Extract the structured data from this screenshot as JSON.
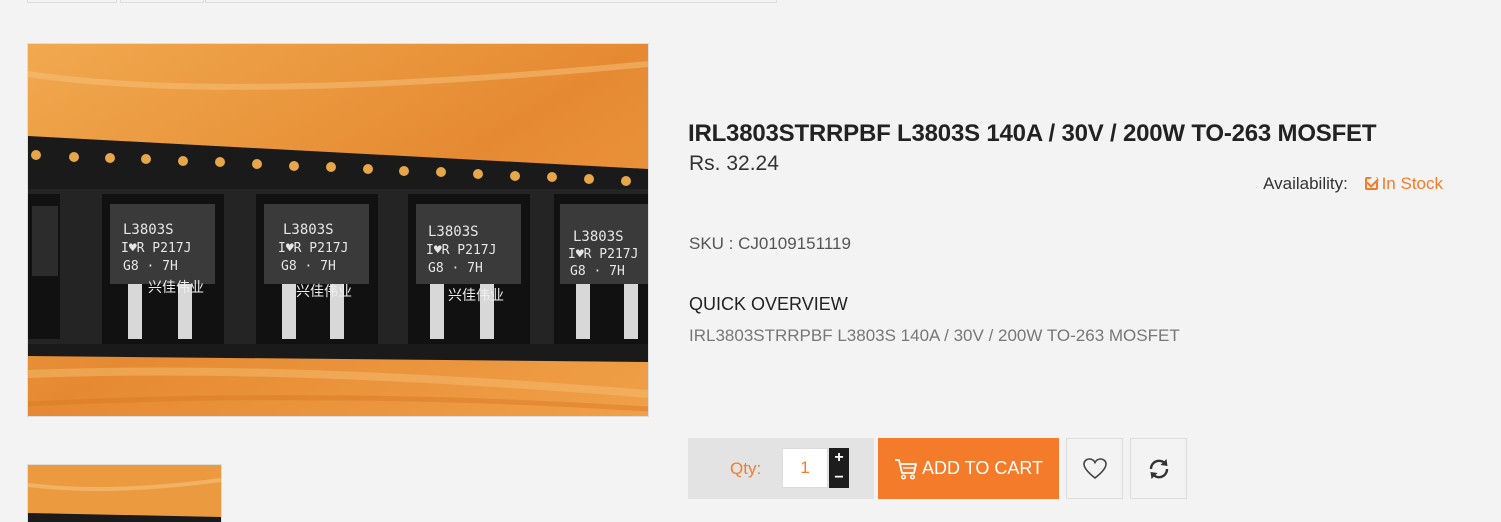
{
  "product": {
    "title": "IRL3803STRRPBF L3803S 140A / 30V / 200W TO-263 MOSFET",
    "price": "Rs. 32.24",
    "availability_label": "Availability:",
    "availability_value": "In Stock",
    "sku": "SKU : CJ0109151119",
    "quick_overview_heading": "QUICK OVERVIEW",
    "quick_overview_text": "IRL3803STRRPBF L3803S 140A / 30V / 200W TO-263 MOSFET"
  },
  "image": {
    "chip_marking_line1": "L3803S",
    "chip_marking_line2": "I♥R P217J",
    "chip_marking_line3": "G8 · 7H",
    "tape_watermark": "兴佳伟业"
  },
  "cart": {
    "qty_label": "Qty:",
    "qty_value": "1",
    "plus": "+",
    "minus": "−",
    "add_to_cart_label": "ADD TO CART"
  },
  "colors": {
    "accent": "#f47b2a",
    "background": "#f3f3f3",
    "wood": "#e8953a",
    "tape": "#1a1a1a"
  },
  "icons": {
    "availability": "check-square-icon",
    "cart": "cart-icon",
    "wishlist": "heart-icon",
    "compare": "refresh-icon"
  }
}
